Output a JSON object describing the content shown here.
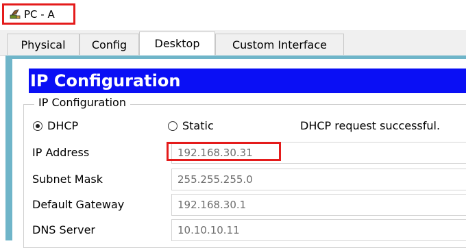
{
  "window": {
    "title": "PC - A",
    "icon": "network-device-icon"
  },
  "tabs": [
    {
      "label": "Physical",
      "active": false
    },
    {
      "label": "Config",
      "active": false
    },
    {
      "label": "Desktop",
      "active": true
    },
    {
      "label": "Custom Interface",
      "active": false
    }
  ],
  "ip_config": {
    "banner": "IP Configuration",
    "group_label": "IP Configuration",
    "dhcp_label": "DHCP",
    "dhcp_selected": true,
    "static_label": "Static",
    "static_selected": false,
    "status": "DHCP request successful.",
    "fields": [
      {
        "label": "IP Address",
        "value": "192.168.30.31"
      },
      {
        "label": "Subnet Mask",
        "value": "255.255.255.0"
      },
      {
        "label": "Default Gateway",
        "value": "192.168.30.1"
      },
      {
        "label": "DNS Server",
        "value": "10.10.10.11"
      }
    ]
  },
  "colors": {
    "banner_bg": "#0a0ff5",
    "highlight": "#e41b1b",
    "frame": "#6fb5c9"
  }
}
